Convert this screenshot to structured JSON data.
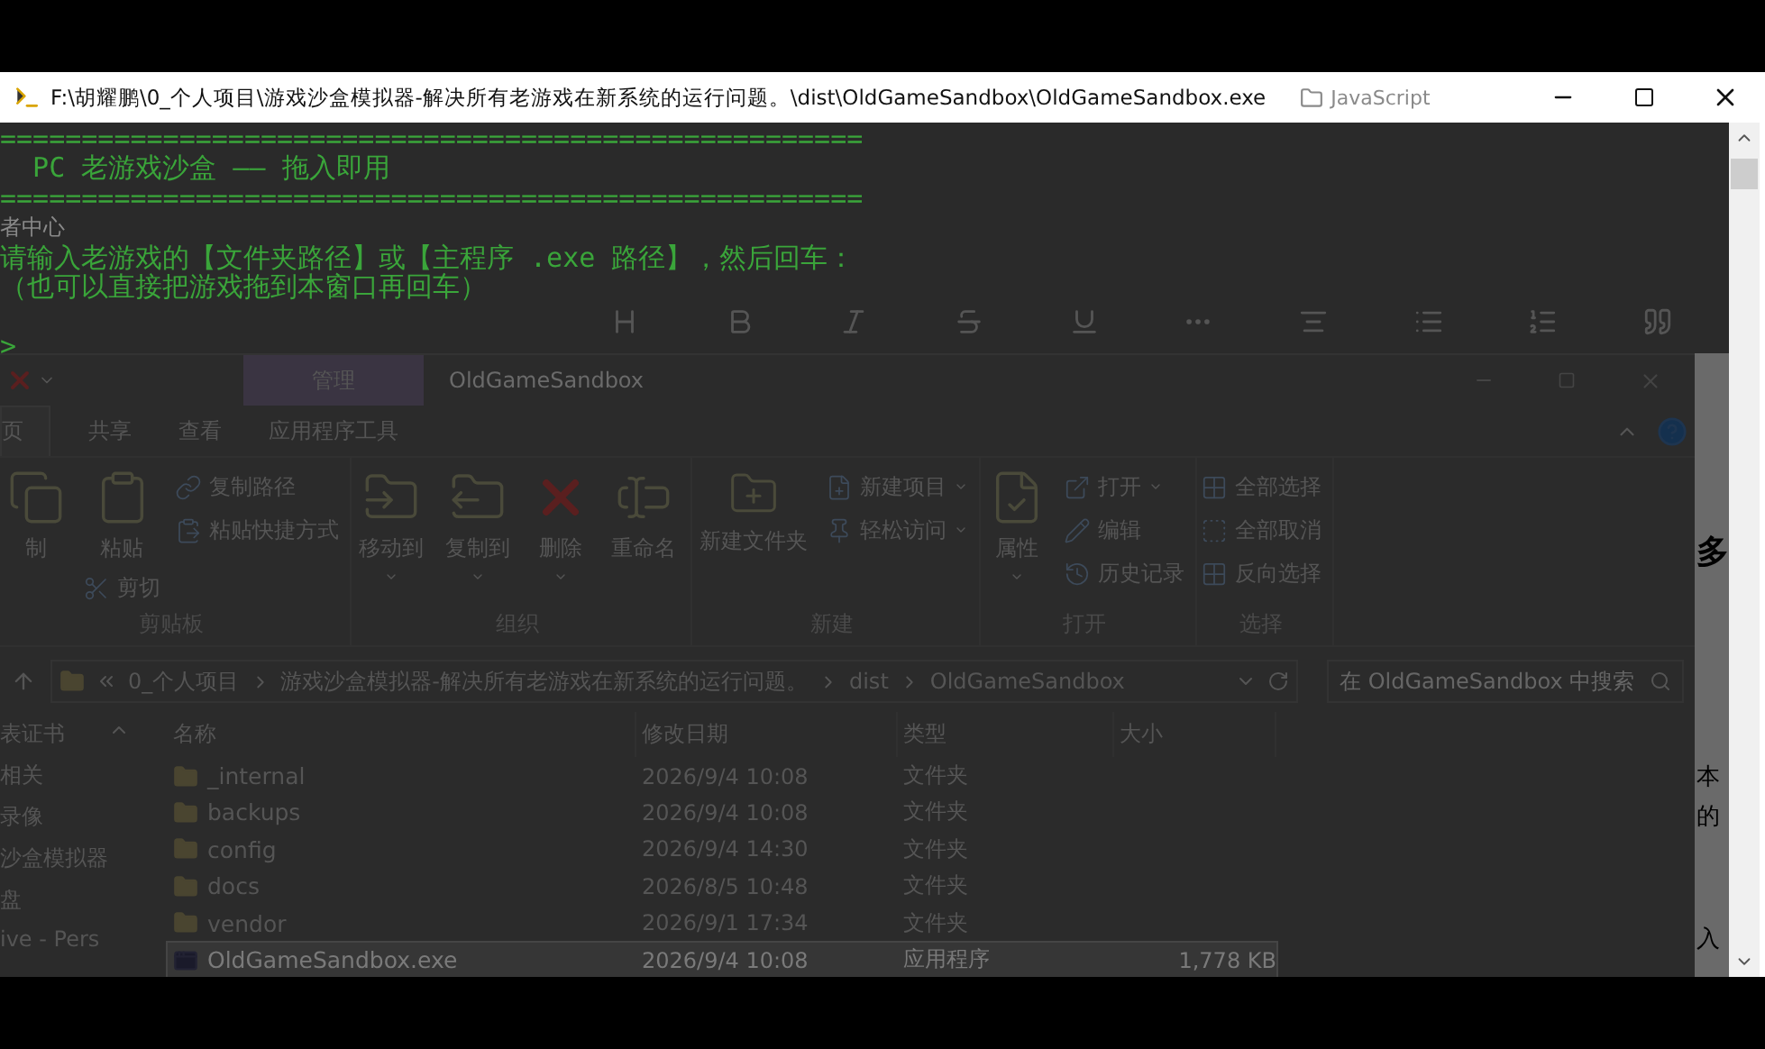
{
  "console": {
    "title": "F:\\胡耀鹏\\0_个人项目\\游戏沙盒模拟器-解决所有老游戏在新系统的运行问题。\\dist\\OldGameSandbox\\OldGameSandbox.exe",
    "lines": [
      {
        "kind": "rule",
        "text": "=====================================================",
        "spaced": false
      },
      {
        "kind": "text",
        "text": "  PC 老游戏沙盒 —— 拖入即用",
        "spaced": false
      },
      {
        "kind": "rule",
        "text": "=====================================================",
        "spaced": false
      },
      {
        "kind": "ghost",
        "text": "者中心",
        "spaced": false
      },
      {
        "kind": "text",
        "text": "请输入老游戏的【文件夹路径】或【主程序 .exe 路径】，然后回车：",
        "spaced": false
      },
      {
        "kind": "text",
        "text": "（也可以直接把游戏拖到本窗口再回车）",
        "spaced": false
      },
      {
        "kind": "prompt",
        "text": ">",
        "spaced": true
      }
    ]
  },
  "browser_behind": {
    "bookmark": "JavaScript",
    "side_texts": [
      "多",
      "本",
      "的",
      "入"
    ]
  },
  "explorer": {
    "window_title": "OldGameSandbox",
    "context_tab": "管理",
    "ribbon_tabs": [
      {
        "label": "页",
        "selected": true
      },
      {
        "label": "共享",
        "selected": false
      },
      {
        "label": "查看",
        "selected": false
      },
      {
        "label": "应用程序工具",
        "selected": false
      }
    ],
    "ribbon_groups": [
      {
        "label": "剪贴板",
        "columns": [
          [
            {
              "kind": "large",
              "label": "制",
              "dropdown": false
            }
          ],
          [
            {
              "kind": "large",
              "label": "粘贴",
              "dropdown": false
            },
            {
              "kind": "small",
              "label": "剪切",
              "dropdown": false
            }
          ],
          [
            {
              "kind": "small",
              "label": "复制路径",
              "dropdown": false
            },
            {
              "kind": "small",
              "label": "粘贴快捷方式",
              "dropdown": false
            }
          ]
        ]
      },
      {
        "label": "组织",
        "columns": [
          [
            {
              "kind": "large",
              "label": "移动到",
              "dropdown": true
            }
          ],
          [
            {
              "kind": "large",
              "label": "复制到",
              "dropdown": true
            }
          ],
          [
            {
              "kind": "large",
              "label": "删除",
              "dropdown": true
            }
          ],
          [
            {
              "kind": "large",
              "label": "重命名",
              "dropdown": false
            }
          ]
        ]
      },
      {
        "label": "新建",
        "columns": [
          [
            {
              "kind": "large",
              "label": "新建文件夹",
              "dropdown": false
            }
          ],
          [
            {
              "kind": "small",
              "label": "新建项目",
              "dropdown": true
            },
            {
              "kind": "small",
              "label": "轻松访问",
              "dropdown": true
            }
          ]
        ]
      },
      {
        "label": "打开",
        "columns": [
          [
            {
              "kind": "large",
              "label": "属性",
              "dropdown": true
            }
          ],
          [
            {
              "kind": "small",
              "label": "打开",
              "dropdown": true
            },
            {
              "kind": "small",
              "label": "编辑",
              "dropdown": false
            },
            {
              "kind": "small",
              "label": "历史记录",
              "dropdown": false
            }
          ]
        ]
      },
      {
        "label": "选择",
        "columns": [
          [
            {
              "kind": "small",
              "label": "全部选择",
              "dropdown": false
            },
            {
              "kind": "small",
              "label": "全部取消",
              "dropdown": false
            },
            {
              "kind": "small",
              "label": "反向选择",
              "dropdown": false
            }
          ]
        ]
      }
    ],
    "address": {
      "crumbs": [
        "0_个人项目",
        "游戏沙盒模拟器-解决所有老游戏在新系统的运行问题。",
        "dist",
        "OldGameSandbox"
      ],
      "search_placeholder": "在 OldGameSandbox 中搜索"
    },
    "nav_items": [
      "表证书",
      "相关",
      "录像",
      "沙盒模拟器",
      "盘",
      "ive - Pers"
    ],
    "columns": [
      "名称",
      "修改日期",
      "类型",
      "大小"
    ],
    "files": [
      {
        "kind": "folder",
        "name": "_internal",
        "date": "2026/9/4 10:08",
        "type": "文件夹",
        "selected": false
      },
      {
        "kind": "folder",
        "name": "backups",
        "date": "2026/9/4 10:08",
        "type": "文件夹",
        "selected": false
      },
      {
        "kind": "folder",
        "name": "config",
        "date": "2026/9/4 14:30",
        "type": "文件夹",
        "selected": false
      },
      {
        "kind": "folder",
        "name": "docs",
        "date": "2026/8/5 10:48",
        "type": "文件夹",
        "selected": false
      },
      {
        "kind": "folder",
        "name": "vendor",
        "date": "2026/9/1 17:34",
        "type": "文件夹",
        "selected": false
      },
      {
        "kind": "app",
        "name": "OldGameSandbox.exe",
        "date": "2026/9/4 10:08",
        "type": "应用程序",
        "size": "1,778 KB",
        "selected": true
      }
    ]
  }
}
